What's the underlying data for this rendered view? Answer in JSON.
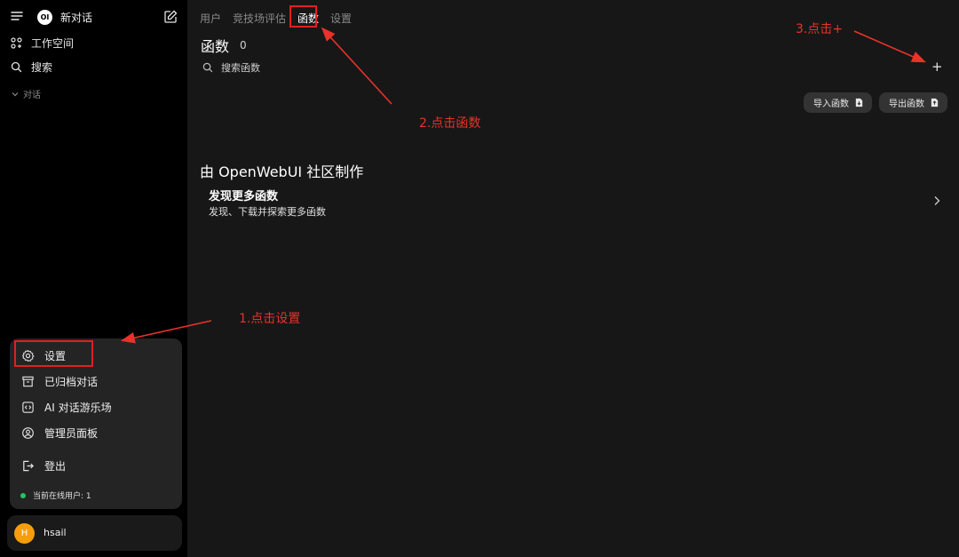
{
  "sidebar": {
    "new_chat": "新对话",
    "workspace": "工作空间",
    "search": "搜索",
    "chats_section": "对话",
    "menu": {
      "settings": "设置",
      "archived": "已归档对话",
      "playground": "AI 对话游乐场",
      "admin": "管理员面板",
      "logout": "登出",
      "online": "当前在线用户: 1"
    },
    "user": {
      "initial": "H",
      "name": "hsail"
    }
  },
  "main": {
    "tabs": [
      "用户",
      "竞技场评估",
      "函数",
      "设置"
    ],
    "active_tab": "函数",
    "title": "函数",
    "count": "0",
    "search_placeholder": "搜索函数",
    "add_label": "+",
    "import_label": "导入函数",
    "export_label": "导出函数",
    "community_heading": "由 OpenWebUI 社区制作",
    "discover_title": "发现更多函数",
    "discover_desc": "发现、下载并探索更多函数"
  },
  "annotations": {
    "step1": "1.点击设置",
    "step2": "2.点击函数",
    "step3": "3.点击+"
  },
  "colors": {
    "annotation": "#e8322a",
    "online_dot": "#22c55e",
    "avatar": "#f59e0b"
  }
}
